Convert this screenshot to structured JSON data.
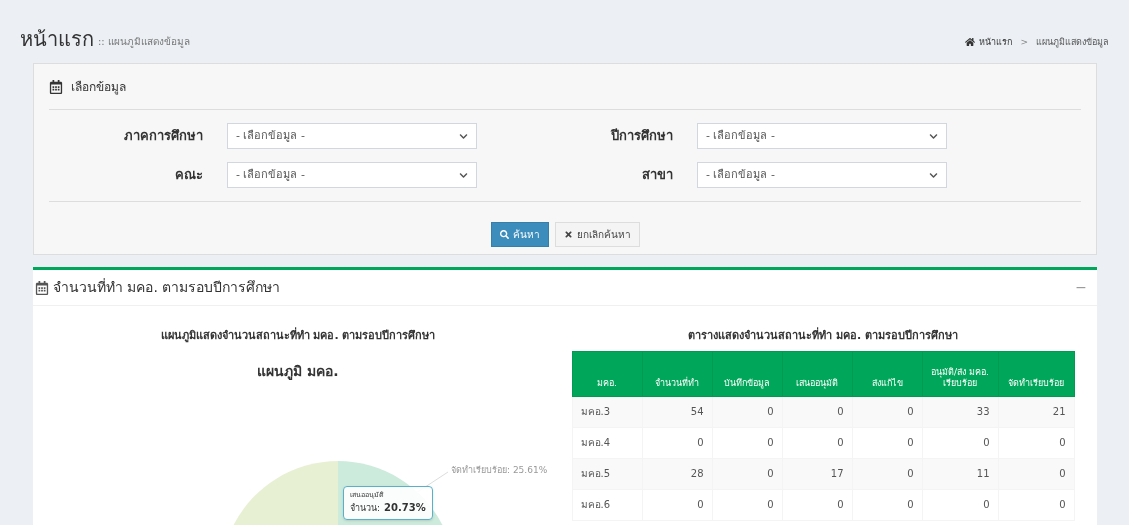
{
  "header": {
    "title": "หน้าแรก",
    "subtitle": ":: แผนภูมิแสดงข้อมูล",
    "breadcrumb": [
      "หน้าแรก",
      "แผนภูมิแสดงข้อมูล"
    ],
    "separator": ">"
  },
  "filter_panel": {
    "title": "เลือกข้อมูล",
    "fields": [
      {
        "label": "ภาคการศึกษา",
        "value": "- เลือกข้อมูล -"
      },
      {
        "label": "ปีการศึกษา",
        "value": "- เลือกข้อมูล -"
      },
      {
        "label": "คณะ",
        "value": "- เลือกข้อมูล -"
      },
      {
        "label": "สาขา",
        "value": "- เลือกข้อมูล -"
      }
    ],
    "buttons": [
      {
        "kind": "primary",
        "label": "ค้นหา"
      },
      {
        "kind": "default",
        "label": "ยกเลิกค้นหา"
      }
    ]
  },
  "stats_panel": {
    "title": "จำนวนที่ทำ มคอ. ตามรอบปีการศึกษา",
    "collapse": "−",
    "chart": {
      "caption": "แผนภูมิแสดงจำนวนสถานะที่ทำ มคอ. ตามรอบปีการศึกษา",
      "title": "แผนภูมิ มคอ.",
      "slice_label": "จัดทำเรียบร้อย: 25.61%",
      "tooltip": {
        "series": "เสนออนุมัติ",
        "label": "จำนวน:",
        "value": "20.73%"
      }
    },
    "table": {
      "caption": "ตารางแสดงจำนวนสถานะที่ทำ มคอ. ตามรอบปีการศึกษา",
      "columns": [
        "มคอ.",
        "จำนวนที่ทำ",
        "บันทึกข้อมูล",
        "เสนออนุมัติ",
        "ส่งแก้ไข",
        "อนุมัติ/ส่ง มคอ. เรียบร้อย",
        "จัดทำเรียบร้อย"
      ],
      "rows": [
        [
          "มคอ.3",
          "54",
          "0",
          "0",
          "0",
          "33",
          "21"
        ],
        [
          "มคอ.4",
          "0",
          "0",
          "0",
          "0",
          "0",
          "0"
        ],
        [
          "มคอ.5",
          "28",
          "0",
          "17",
          "0",
          "11",
          "0"
        ],
        [
          "มคอ.6",
          "0",
          "0",
          "0",
          "0",
          "0",
          "0"
        ]
      ]
    }
  }
}
